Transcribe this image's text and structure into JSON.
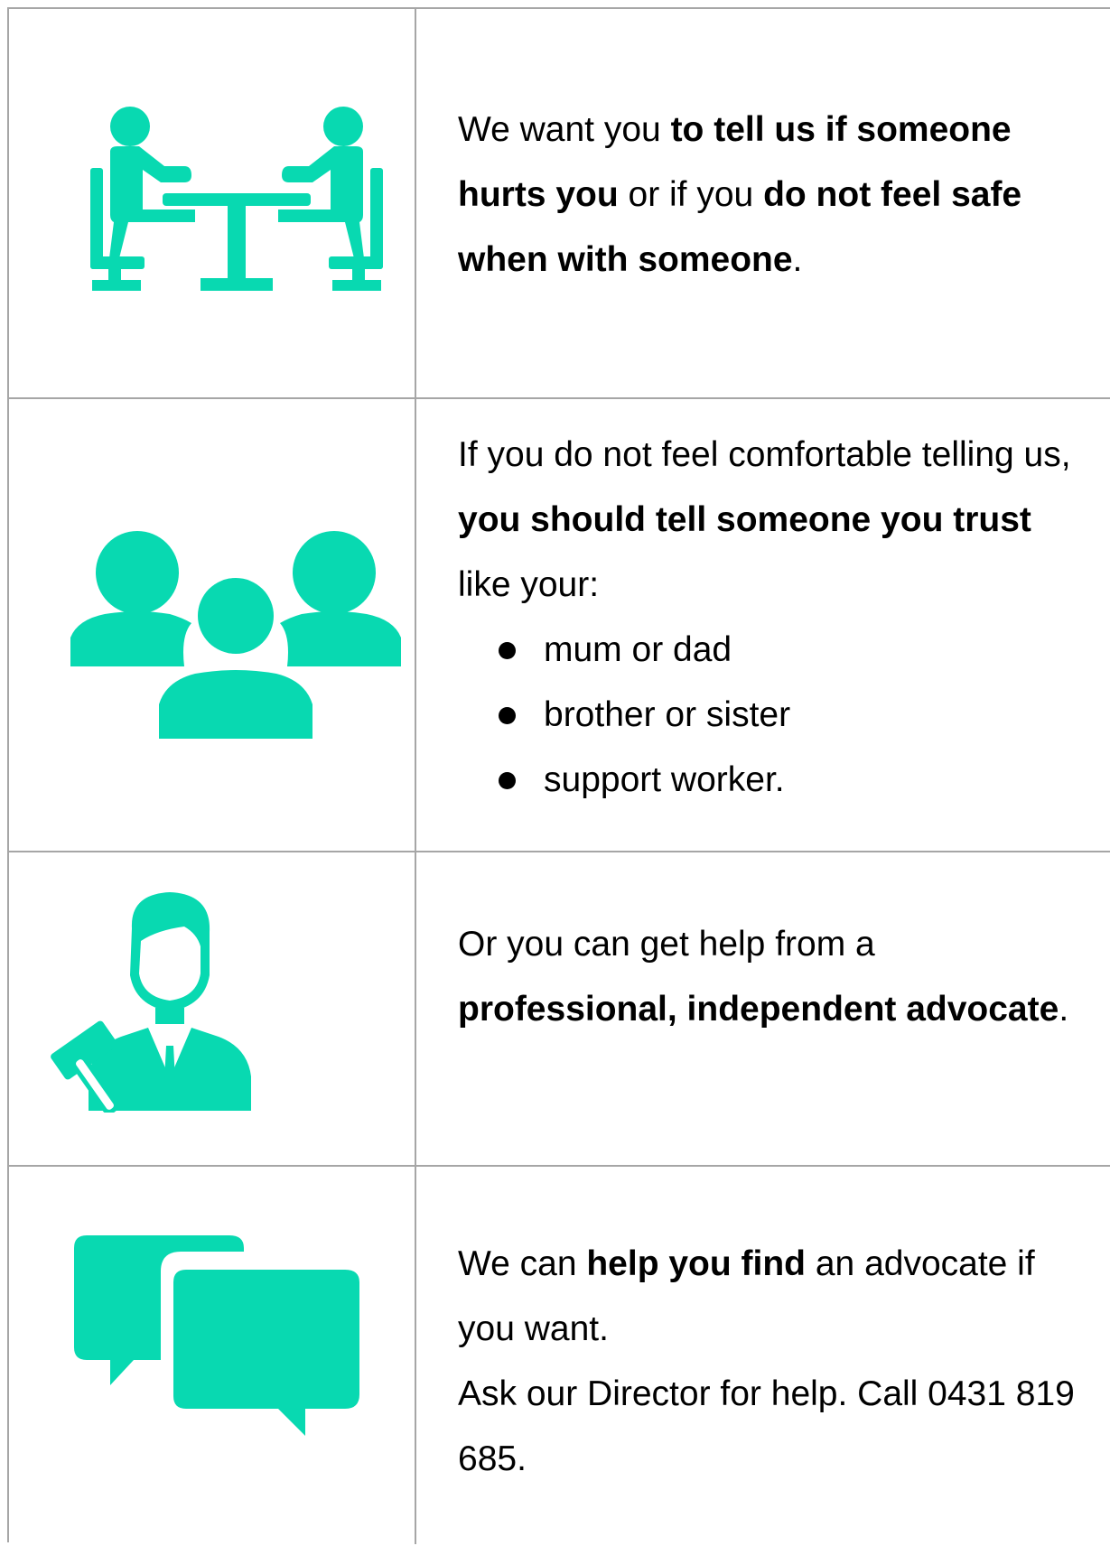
{
  "accent_color": "#08d9b1",
  "rows": [
    {
      "icon": "meeting-table-icon",
      "segments": [
        {
          "text": "We want you ",
          "bold": false
        },
        {
          "text": "to tell us if someone hurts you",
          "bold": true
        },
        {
          "text": " or if you ",
          "bold": false
        },
        {
          "text": "do not feel safe when with someone",
          "bold": true
        },
        {
          "text": ".",
          "bold": false
        }
      ]
    },
    {
      "icon": "people-group-icon",
      "segments": [
        {
          "text": "If you do not feel comfortable telling us, ",
          "bold": false
        },
        {
          "text": "you should tell someone you trust",
          "bold": true
        },
        {
          "text": " like your:",
          "bold": false
        }
      ],
      "bullets": [
        "mum or dad",
        "brother or sister",
        "support worker."
      ]
    },
    {
      "icon": "advocate-gavel-icon",
      "segments": [
        {
          "text": "Or you can get help from a ",
          "bold": false
        },
        {
          "text": "professional, independent advocate",
          "bold": true
        },
        {
          "text": ".",
          "bold": false
        }
      ]
    },
    {
      "icon": "chat-bubbles-icon",
      "segments": [
        {
          "text": "We can ",
          "bold": false
        },
        {
          "text": "help you find",
          "bold": true
        },
        {
          "text": " an advocate if you want.",
          "bold": false
        }
      ],
      "extra_line": "Ask our Director for help. Call 0431 819 685."
    }
  ]
}
